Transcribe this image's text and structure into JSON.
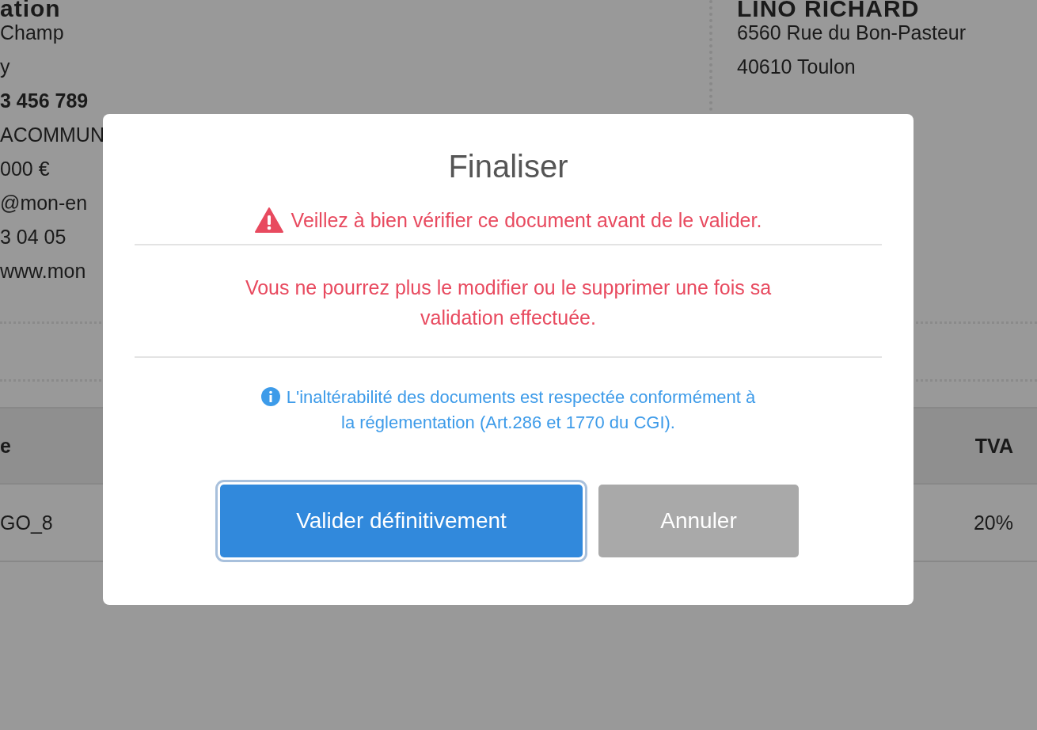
{
  "background": {
    "seller": {
      "heading": "ation",
      "lines": [
        {
          "text": "Champ",
          "bold": false
        },
        {
          "text": "y",
          "bold": false
        },
        {
          "text": "3 456 789",
          "bold": true
        },
        {
          "text": "ACOMMUN",
          "bold": false
        },
        {
          "text": "000 €",
          "bold": false
        },
        {
          "text": "@mon-en",
          "bold": false
        },
        {
          "text": "3 04 05",
          "bold": false
        },
        {
          "text": "www.mon",
          "bold": false
        }
      ]
    },
    "client": {
      "heading": "LINO RICHARD",
      "lines": [
        "6560 Rue du Bon-Pasteur",
        "40610 Toulon"
      ]
    },
    "table": {
      "columns": [
        "e",
        "TVA"
      ],
      "rows": [
        [
          "GO_8",
          "20%"
        ]
      ]
    }
  },
  "dialog": {
    "title": "Finaliser",
    "warning": "Veillez à bien vérifier ce document avant de le valider.",
    "notice": "Vous ne pourrez plus le modifier ou le supprimer une fois sa validation effectuée.",
    "info": "L'inaltérabilité des documents est respectée conformément à la réglementation (Art.286 et 1770 du CGI).",
    "buttons": [
      {
        "label": "Valider définitivement",
        "kind": "primary",
        "focused": true
      },
      {
        "label": "Annuler",
        "kind": "secondary",
        "focused": false
      }
    ]
  }
}
